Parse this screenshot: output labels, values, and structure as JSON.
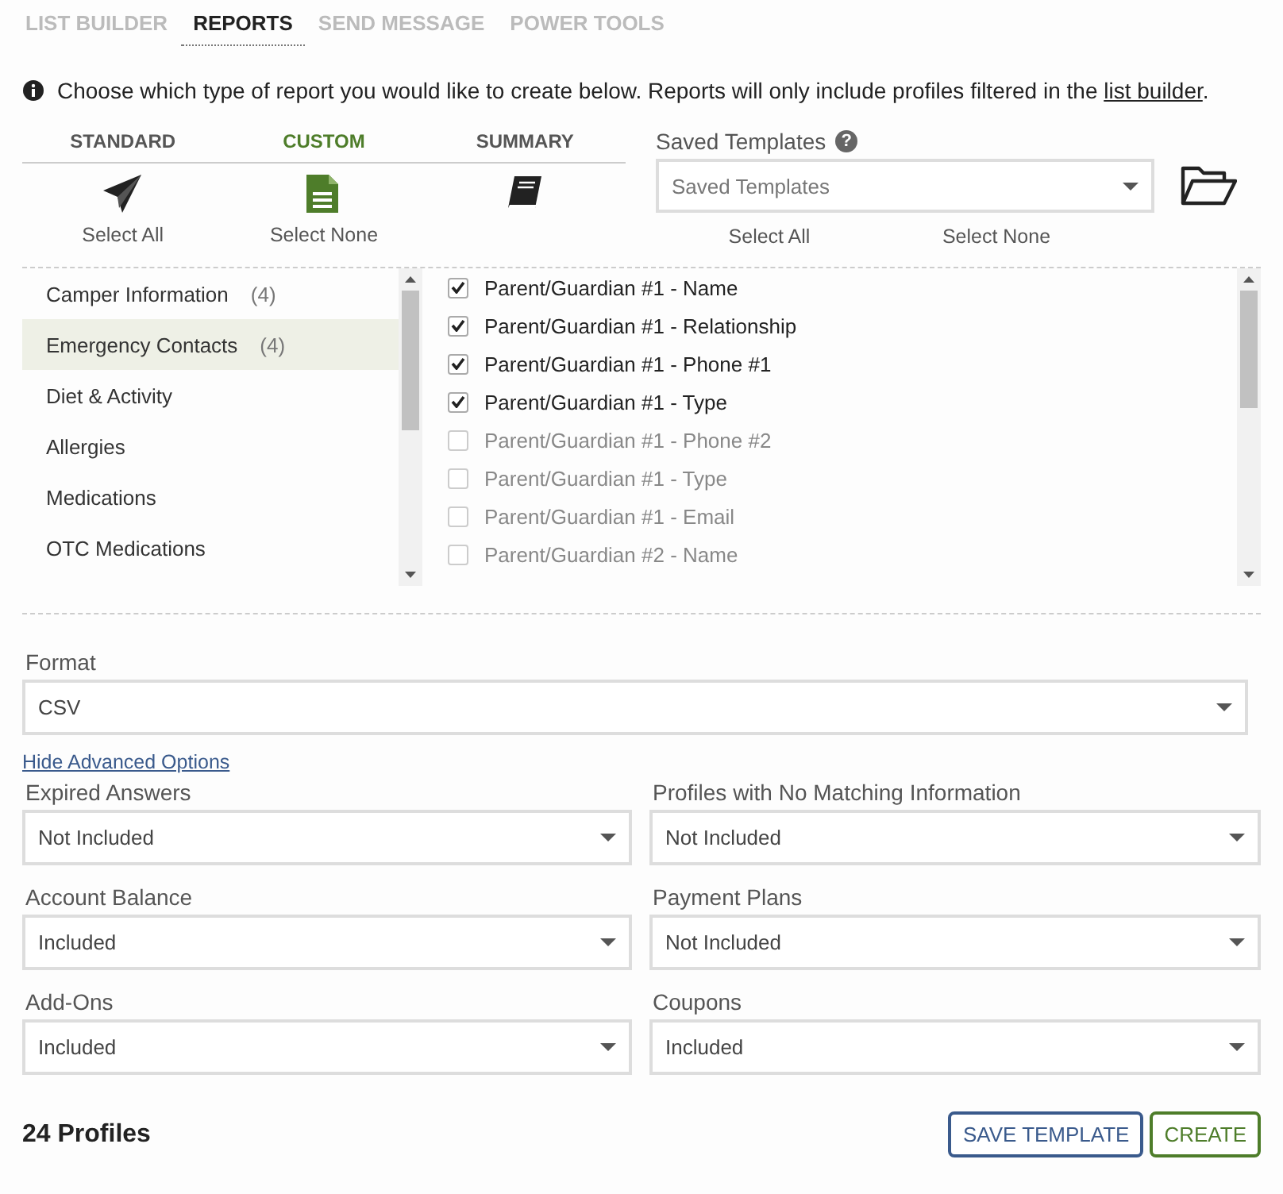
{
  "tabs": [
    {
      "label": "LIST BUILDER",
      "selected": false
    },
    {
      "label": "REPORTS",
      "selected": true
    },
    {
      "label": "SEND MESSAGE",
      "selected": false
    },
    {
      "label": "POWER TOOLS",
      "selected": false
    }
  ],
  "intro": {
    "text": "Choose which type of report you would like to create below. Reports will only include profiles filtered in the ",
    "link": "list builder",
    "end": "."
  },
  "report_types": [
    {
      "label": "STANDARD",
      "selected": false
    },
    {
      "label": "CUSTOM",
      "selected": true
    },
    {
      "label": "SUMMARY",
      "selected": false
    }
  ],
  "report_type_actions": [
    "Select All",
    "Select None"
  ],
  "saved_templates": {
    "label": "Saved Templates",
    "help": "?",
    "placeholder": "Saved Templates",
    "actions": [
      "Select All",
      "Select None"
    ]
  },
  "categories": [
    {
      "label": "Camper Information",
      "count": "(4)",
      "selected": false
    },
    {
      "label": "Emergency Contacts",
      "count": "(4)",
      "selected": true
    },
    {
      "label": "Diet & Activity",
      "selected": false
    },
    {
      "label": "Allergies",
      "selected": false
    },
    {
      "label": "Medications",
      "selected": false
    },
    {
      "label": "OTC Medications",
      "selected": false
    }
  ],
  "fields": [
    {
      "label": "Parent/Guardian #1 - Name",
      "checked": true
    },
    {
      "label": "Parent/Guardian #1 - Relationship",
      "checked": true
    },
    {
      "label": "Parent/Guardian #1 - Phone #1",
      "checked": true
    },
    {
      "label": "Parent/Guardian #1 - Type",
      "checked": true
    },
    {
      "label": "Parent/Guardian #1 - Phone #2",
      "checked": false
    },
    {
      "label": "Parent/Guardian #1 - Type",
      "checked": false
    },
    {
      "label": "Parent/Guardian #1 - Email",
      "checked": false
    },
    {
      "label": "Parent/Guardian #2 - Name",
      "checked": false
    }
  ],
  "format": {
    "label": "Format",
    "value": "CSV"
  },
  "advanced_link": "Hide Advanced Options",
  "advanced_options": [
    {
      "label": "Expired Answers",
      "value": "Not Included"
    },
    {
      "label": "Profiles with No Matching Information",
      "value": "Not Included"
    },
    {
      "label": "Account Balance",
      "value": "Included"
    },
    {
      "label": "Payment Plans",
      "value": "Not Included"
    },
    {
      "label": "Add-Ons",
      "value": "Included"
    },
    {
      "label": "Coupons",
      "value": "Included"
    }
  ],
  "footer": {
    "count": "24 Profiles",
    "buttons": [
      "SAVE TEMPLATE",
      "CREATE"
    ]
  }
}
